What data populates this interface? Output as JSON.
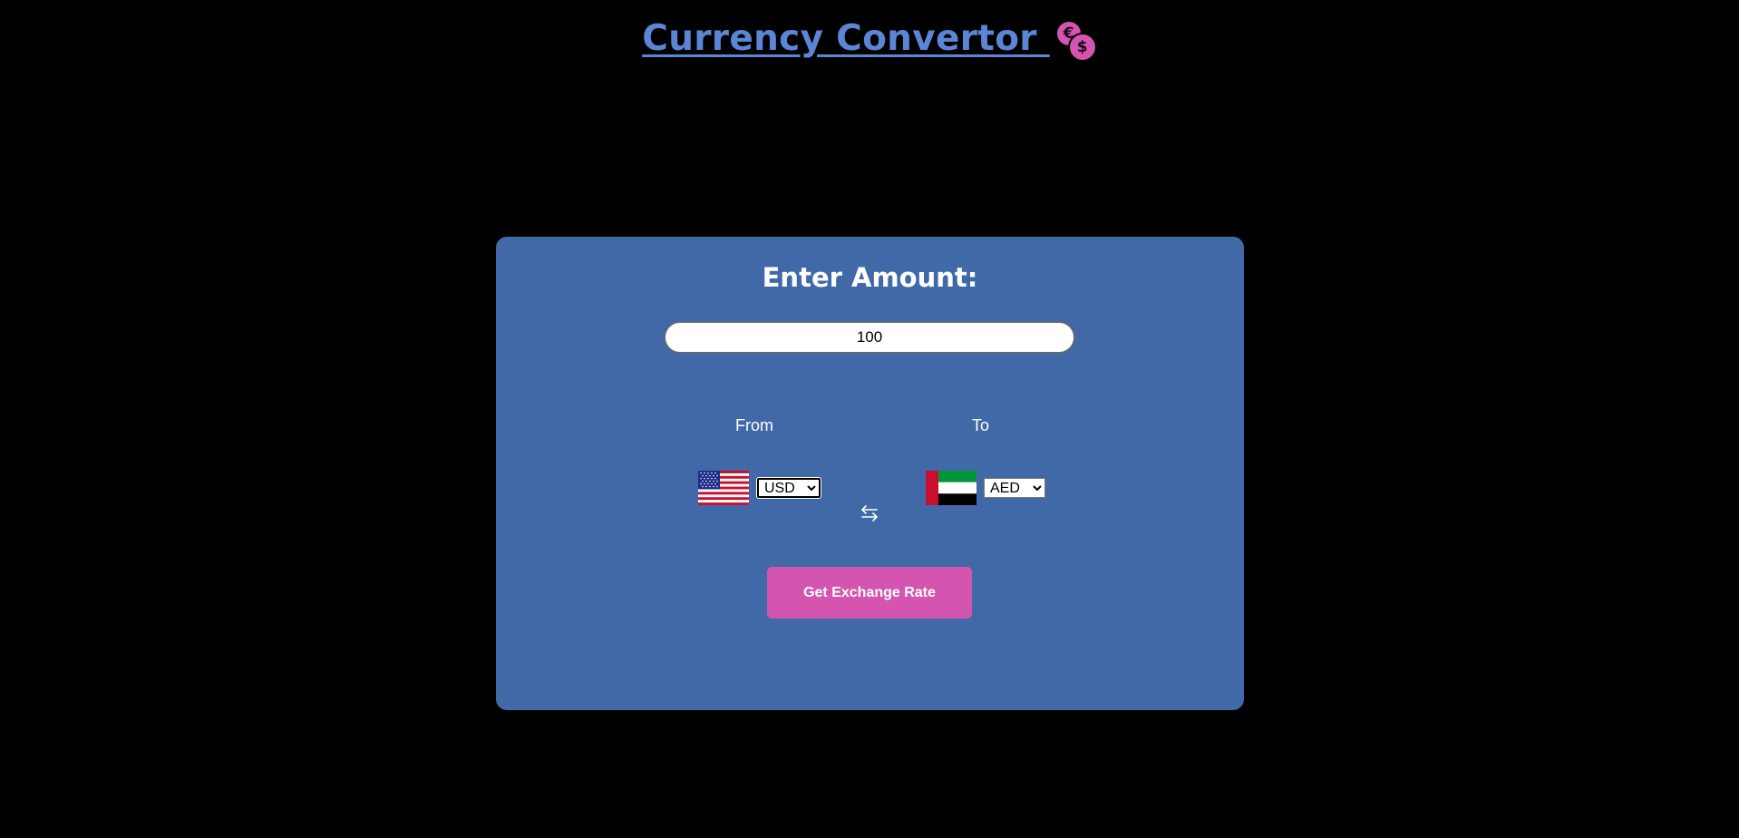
{
  "header": {
    "title": "Currency Convertor ",
    "icons": [
      "euro-coin-icon",
      "dollar-coin-icon"
    ],
    "coin_symbols": {
      "euro": "€",
      "dollar": "$"
    }
  },
  "converter": {
    "heading": "Enter Amount:",
    "amount_value": "100",
    "from_label": "From",
    "to_label": "To",
    "from_currency": {
      "selected": "USD",
      "options": [
        "USD"
      ],
      "flag": "us-flag-icon"
    },
    "to_currency": {
      "selected": "AED",
      "options": [
        "AED"
      ],
      "flag": "uae-flag-icon"
    },
    "swap_icon": "swap-arrows-icon",
    "button_label": "Get Exchange Rate"
  },
  "colors": {
    "background": "#000000",
    "card": "#4169a7",
    "title": "#5b86d6",
    "accent": "#d455b0",
    "text": "#ffffff"
  }
}
